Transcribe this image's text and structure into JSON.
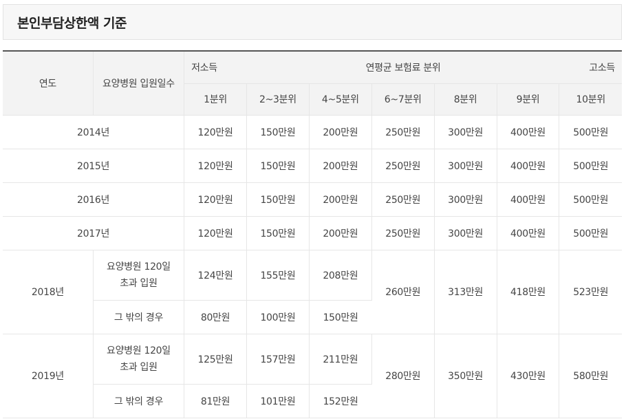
{
  "title": "본인부담상한액 기준",
  "header": {
    "year": "연도",
    "days": "요양병원 입원일수",
    "low": "저소득",
    "mid": "연평균 보험료 분위",
    "high": "고소득",
    "deciles": [
      "1분위",
      "2~3분위",
      "4~5분위",
      "6~7분위",
      "8분위",
      "9분위",
      "10분위"
    ]
  },
  "simple_rows": [
    {
      "year": "2014년",
      "values": [
        "120만원",
        "150만원",
        "200만원",
        "250만원",
        "300만원",
        "400만원",
        "500만원"
      ]
    },
    {
      "year": "2015년",
      "values": [
        "120만원",
        "150만원",
        "200만원",
        "250만원",
        "300만원",
        "400만원",
        "500만원"
      ]
    },
    {
      "year": "2016년",
      "values": [
        "120만원",
        "150만원",
        "200만원",
        "250만원",
        "300만원",
        "400만원",
        "500만원"
      ]
    },
    {
      "year": "2017년",
      "values": [
        "120만원",
        "150만원",
        "200만원",
        "250만원",
        "300만원",
        "400만원",
        "500만원"
      ]
    }
  ],
  "split_rows": [
    {
      "year": "2018년",
      "case_a": {
        "line1": "요양병원 120일",
        "line2": "초과 입원",
        "values": [
          "124만원",
          "155만원",
          "208만원"
        ]
      },
      "case_b": {
        "label": "그 밖의 경우",
        "values": [
          "80만원",
          "100만원",
          "150만원"
        ]
      },
      "shared": [
        "260만원",
        "313만원",
        "418만원",
        "523만원"
      ]
    },
    {
      "year": "2019년",
      "case_a": {
        "line1": "요양병원 120일",
        "line2": "초과 입원",
        "values": [
          "125만원",
          "157만원",
          "211만원"
        ]
      },
      "case_b": {
        "label": "그 밖의 경우",
        "values": [
          "81만원",
          "101만원",
          "152만원"
        ]
      },
      "shared": [
        "280만원",
        "350만원",
        "430만원",
        "580만원"
      ]
    }
  ]
}
